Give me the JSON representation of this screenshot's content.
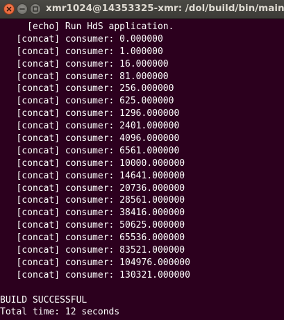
{
  "window": {
    "title": "xmr1024@14353325-xmr: /dol/build/bin/main"
  },
  "terminal": {
    "lines": [
      "     [echo] Run HdS application.",
      "   [concat] consumer: 0.000000",
      "   [concat] consumer: 1.000000",
      "   [concat] consumer: 16.000000",
      "   [concat] consumer: 81.000000",
      "   [concat] consumer: 256.000000",
      "   [concat] consumer: 625.000000",
      "   [concat] consumer: 1296.000000",
      "   [concat] consumer: 2401.000000",
      "   [concat] consumer: 4096.000000",
      "   [concat] consumer: 6561.000000",
      "   [concat] consumer: 10000.000000",
      "   [concat] consumer: 14641.000000",
      "   [concat] consumer: 20736.000000",
      "   [concat] consumer: 28561.000000",
      "   [concat] consumer: 38416.000000",
      "   [concat] consumer: 50625.000000",
      "   [concat] consumer: 65536.000000",
      "   [concat] consumer: 83521.000000",
      "   [concat] consumer: 104976.000000",
      "   [concat] consumer: 130321.000000",
      "",
      "BUILD SUCCESSFUL",
      "Total time: 12 seconds"
    ]
  }
}
